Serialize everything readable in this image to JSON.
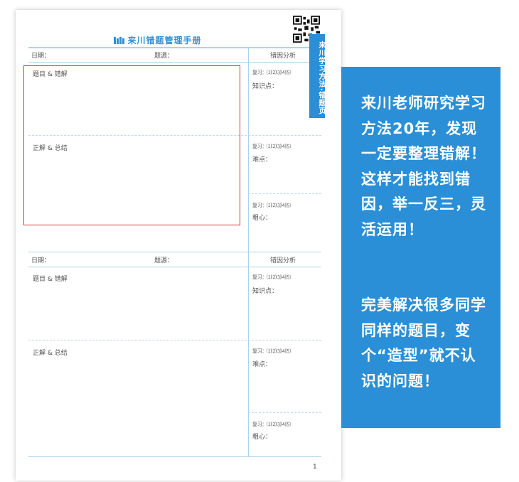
{
  "book": {
    "title": "来川错题管理手册",
    "side_tab": "来川学习方法·错题页",
    "page_number": "1"
  },
  "sections": [
    {
      "date_label": "日期：",
      "source_label": "题源：",
      "analysis_header": "错因分析",
      "question_label": "题目 & 错解",
      "answer_label": "正解 & 总结",
      "review_1": "复习：⑴⑵⑶⑷⑸",
      "review_1_field": "知识点：",
      "review_2": "复习：⑴⑵⑶⑷⑸",
      "review_2_field": "难点：",
      "review_3": "复习：⑴⑵⑶⑷⑸",
      "review_3_field": "粗心："
    },
    {
      "date_label": "日期：",
      "source_label": "题源：",
      "analysis_header": "错因分析",
      "question_label": "题目 & 错解",
      "answer_label": "正解 & 总结",
      "review_1": "复习：⑴⑵⑶⑷⑸",
      "review_1_field": "知识点：",
      "review_2": "复习：⑴⑵⑶⑷⑸",
      "review_2_field": "难点：",
      "review_3": "复习：⑴⑵⑶⑷⑸",
      "review_3_field": "粗心："
    }
  ],
  "panel": {
    "paragraph_1": "来川老师研究学习方法20年，发现一定要整理错解！这样才能找到错因，举一反三，灵活运用！",
    "paragraph_2": "完美解决很多同学同样的题目，变个“造型”就不认识的问题！"
  },
  "colors": {
    "accent_blue": "#2a8fd6",
    "highlight_red": "#e03030",
    "grid_line": "#a9d3ef"
  },
  "icons": [
    "qr-code-icon",
    "logo-icon"
  ]
}
